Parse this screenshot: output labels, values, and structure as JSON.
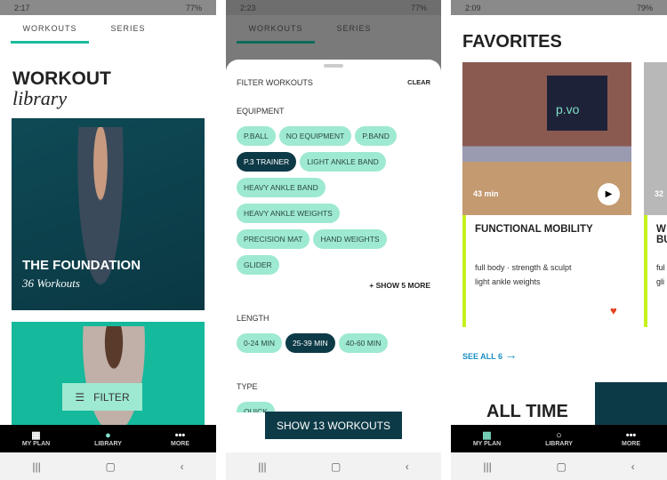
{
  "screens": [
    {
      "status": {
        "time": "2:17",
        "battery": "77%"
      },
      "tabs": [
        "WORKOUTS",
        "SERIES"
      ],
      "title": "WORKOUT",
      "subtitle": "library",
      "card1": {
        "title": "THE FOUNDATION",
        "count": "36 Workouts"
      },
      "filter_label": "FILTER"
    },
    {
      "status": {
        "time": "2:23",
        "battery": "77%"
      },
      "tabs": [
        "WORKOUTS",
        "SERIES"
      ],
      "sheet": {
        "title": "FILTER WORKOUTS",
        "clear": "CLEAR",
        "equipment_label": "EQUIPMENT",
        "equipment": [
          "P.BALL",
          "NO EQUIPMENT",
          "P.BAND",
          "P.3 TRAINER",
          "LIGHT ANKLE BAND",
          "HEAVY ANKLE BAND",
          "HEAVY ANKLE WEIGHTS",
          "PRECISION MAT",
          "HAND WEIGHTS",
          "GLIDER"
        ],
        "equipment_selected": "P.3 TRAINER",
        "show_more": "+ SHOW 5 MORE",
        "length_label": "LENGTH",
        "length": [
          "0-24 MIN",
          "25-39 MIN",
          "40-60 MIN"
        ],
        "length_selected": "25-39 MIN",
        "type_label": "TYPE",
        "type_first": "QUICK",
        "show_button": "SHOW 13 WORKOUTS"
      }
    },
    {
      "status": {
        "time": "2:09",
        "battery": "79%"
      },
      "title": "FAVORITES",
      "card": {
        "duration": "43 min",
        "logo": "p.vo",
        "title": "FUNCTIONAL MOBILITY",
        "tags": "full body · strength & sculpt",
        "equipment": "light ankle weights"
      },
      "card2": {
        "duration": "32",
        "title": "W\nBU",
        "tags": "ful",
        "equipment": "gli"
      },
      "see_all": "SEE ALL 6",
      "section2": "ALL TIME"
    }
  ],
  "nav": {
    "my_plan": "MY PLAN",
    "library": "LIBRARY",
    "more": "MORE"
  },
  "colors": {
    "accent": "#1abc9c",
    "chip": "#9ee9d2",
    "dark": "#0d3a47",
    "lime": "#c6f21c",
    "heart": "#e0401c",
    "link": "#1a8fc0"
  }
}
